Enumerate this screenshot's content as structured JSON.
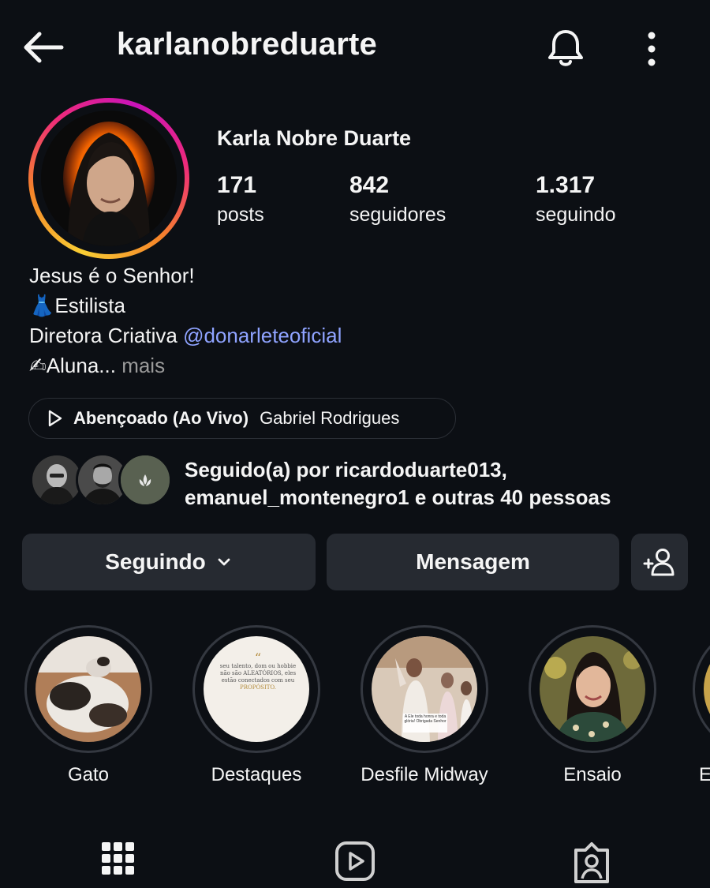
{
  "header": {
    "back_icon": "arrow-left-icon",
    "username": "karlanobreduarte",
    "bell_icon": "bell-icon",
    "menu_icon": "more-vertical-icon"
  },
  "profile": {
    "full_name": "Karla Nobre Duarte",
    "stats": [
      {
        "value": "171",
        "label": "posts"
      },
      {
        "value": "842",
        "label": "seguidores"
      },
      {
        "value": "1.317",
        "label": "seguindo"
      }
    ],
    "bio": {
      "line1": "Jesus é o Senhor!",
      "line2": "👗Estilista",
      "line3_prefix": "Diretora Criativa ",
      "line3_mention": "@donarleteoficial",
      "line4": "✍Aluna...",
      "more": " mais"
    }
  },
  "music": {
    "icon": "play-icon",
    "song": "Abençoado (Ao Vivo)",
    "artist": "Gabriel Rodrigues"
  },
  "followed_by": {
    "line1": "Seguido(a) por ricardoduarte013,",
    "line2": "emanuel_montenegro1 e outras 40 pessoas"
  },
  "actions": {
    "following_label": "Seguindo",
    "message_label": "Mensagem",
    "add_user_icon": "add-user-icon"
  },
  "highlights": [
    {
      "label": "Gato"
    },
    {
      "label": "Destaques"
    },
    {
      "label": "Desfile Midway"
    },
    {
      "label": "Ensaio"
    },
    {
      "label": "E"
    }
  ],
  "quote_card": {
    "mark": "“",
    "text": "seu talento, dom ou hobbie não são ALEATÓRIOS, eles estão conectados com seu",
    "emphasis": "PROPÓSITO."
  },
  "desfile_caption": "A Ele toda honra e toda glória! Obrigada Senhor",
  "tabs": [
    "grid-icon",
    "reels-icon",
    "tagged-icon"
  ],
  "colors": {
    "background": "#0c0f14",
    "button": "#262a31",
    "mention": "#8fa3ff",
    "muted": "#9a9a9a"
  }
}
